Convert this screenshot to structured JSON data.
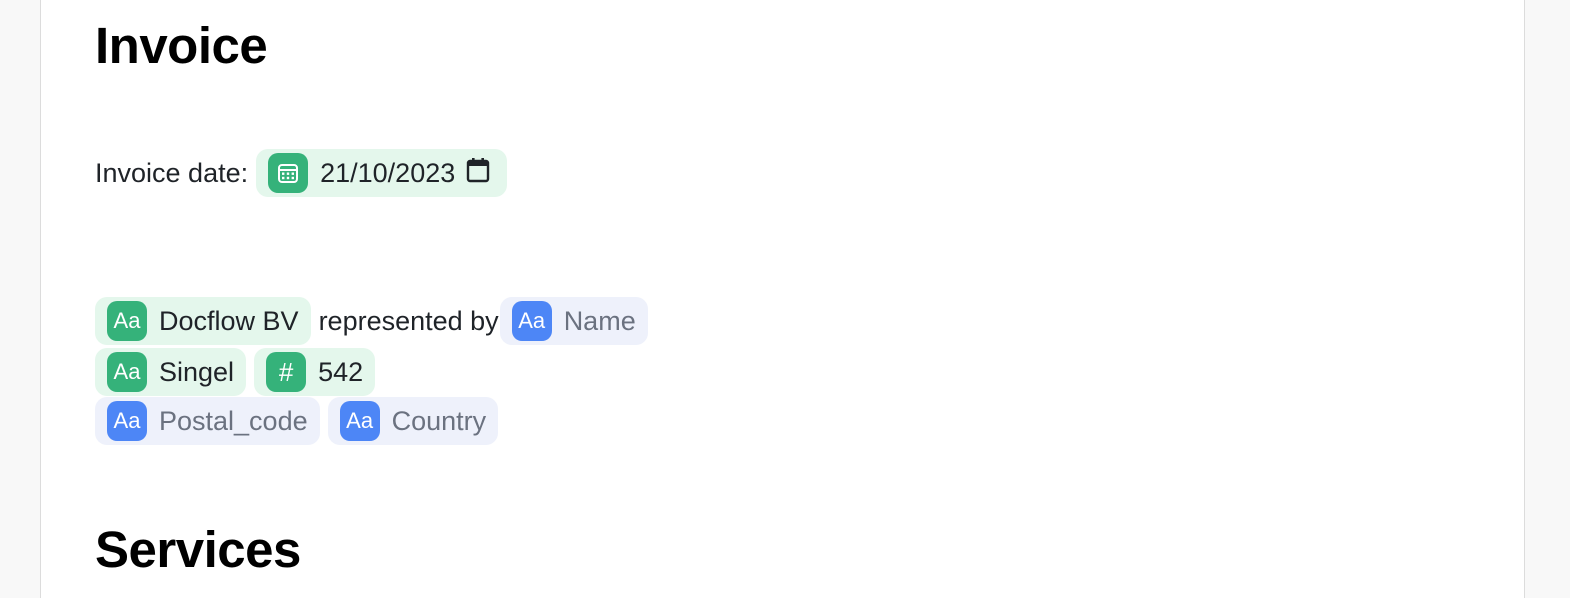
{
  "invoice": {
    "title": "Invoice",
    "date_label": "Invoice date:",
    "date_value": "21/10/2023",
    "company": "Docflow BV",
    "represented_by": "represented by",
    "name_placeholder": "Name",
    "street": "Singel",
    "house_number": "542",
    "postal_code_placeholder": "Postal_code",
    "country_placeholder": "Country"
  },
  "services": {
    "title": "Services"
  },
  "badges": {
    "text_glyph": "Aa",
    "number_glyph": "#"
  },
  "icons": {
    "date_badge": "calendar-grid-icon",
    "date_picker": "calendar-icon",
    "text_field": "text-type-icon",
    "number_field": "hash-icon"
  },
  "colors": {
    "filled_chip_bg": "#e4f7ec",
    "filled_badge": "#35b27a",
    "empty_chip_bg": "#eef1fb",
    "empty_badge": "#4d86f6",
    "placeholder_text": "#6b7280"
  }
}
